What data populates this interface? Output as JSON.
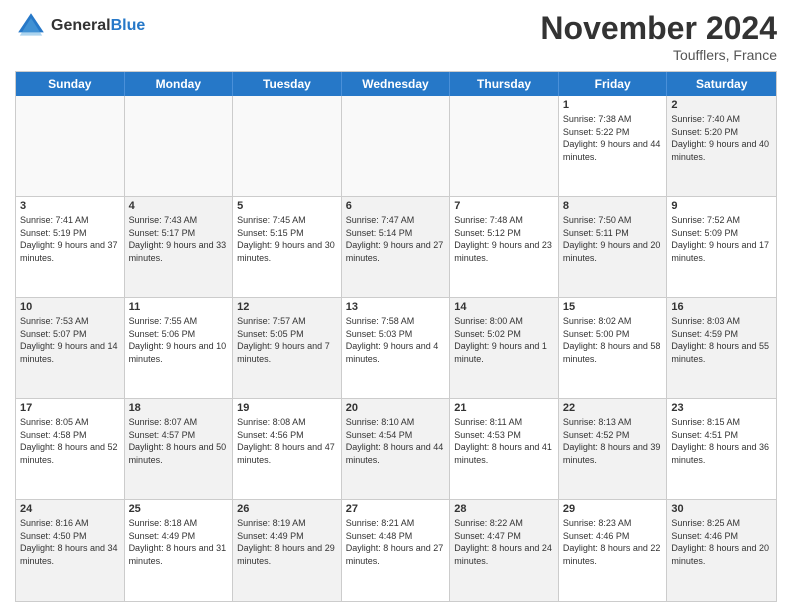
{
  "header": {
    "logo_line1": "General",
    "logo_line2": "Blue",
    "month_title": "November 2024",
    "location": "Toufflers, France"
  },
  "calendar": {
    "days_of_week": [
      "Sunday",
      "Monday",
      "Tuesday",
      "Wednesday",
      "Thursday",
      "Friday",
      "Saturday"
    ],
    "rows": [
      [
        {
          "num": "",
          "info": "",
          "empty": true
        },
        {
          "num": "",
          "info": "",
          "empty": true
        },
        {
          "num": "",
          "info": "",
          "empty": true
        },
        {
          "num": "",
          "info": "",
          "empty": true
        },
        {
          "num": "",
          "info": "",
          "empty": true
        },
        {
          "num": "1",
          "info": "Sunrise: 7:38 AM\nSunset: 5:22 PM\nDaylight: 9 hours\nand 44 minutes.",
          "shaded": false
        },
        {
          "num": "2",
          "info": "Sunrise: 7:40 AM\nSunset: 5:20 PM\nDaylight: 9 hours\nand 40 minutes.",
          "shaded": true
        }
      ],
      [
        {
          "num": "3",
          "info": "Sunrise: 7:41 AM\nSunset: 5:19 PM\nDaylight: 9 hours\nand 37 minutes.",
          "shaded": false
        },
        {
          "num": "4",
          "info": "Sunrise: 7:43 AM\nSunset: 5:17 PM\nDaylight: 9 hours\nand 33 minutes.",
          "shaded": true
        },
        {
          "num": "5",
          "info": "Sunrise: 7:45 AM\nSunset: 5:15 PM\nDaylight: 9 hours\nand 30 minutes.",
          "shaded": false
        },
        {
          "num": "6",
          "info": "Sunrise: 7:47 AM\nSunset: 5:14 PM\nDaylight: 9 hours\nand 27 minutes.",
          "shaded": true
        },
        {
          "num": "7",
          "info": "Sunrise: 7:48 AM\nSunset: 5:12 PM\nDaylight: 9 hours\nand 23 minutes.",
          "shaded": false
        },
        {
          "num": "8",
          "info": "Sunrise: 7:50 AM\nSunset: 5:11 PM\nDaylight: 9 hours\nand 20 minutes.",
          "shaded": true
        },
        {
          "num": "9",
          "info": "Sunrise: 7:52 AM\nSunset: 5:09 PM\nDaylight: 9 hours\nand 17 minutes.",
          "shaded": false
        }
      ],
      [
        {
          "num": "10",
          "info": "Sunrise: 7:53 AM\nSunset: 5:07 PM\nDaylight: 9 hours\nand 14 minutes.",
          "shaded": true
        },
        {
          "num": "11",
          "info": "Sunrise: 7:55 AM\nSunset: 5:06 PM\nDaylight: 9 hours\nand 10 minutes.",
          "shaded": false
        },
        {
          "num": "12",
          "info": "Sunrise: 7:57 AM\nSunset: 5:05 PM\nDaylight: 9 hours\nand 7 minutes.",
          "shaded": true
        },
        {
          "num": "13",
          "info": "Sunrise: 7:58 AM\nSunset: 5:03 PM\nDaylight: 9 hours\nand 4 minutes.",
          "shaded": false
        },
        {
          "num": "14",
          "info": "Sunrise: 8:00 AM\nSunset: 5:02 PM\nDaylight: 9 hours\nand 1 minute.",
          "shaded": true
        },
        {
          "num": "15",
          "info": "Sunrise: 8:02 AM\nSunset: 5:00 PM\nDaylight: 8 hours\nand 58 minutes.",
          "shaded": false
        },
        {
          "num": "16",
          "info": "Sunrise: 8:03 AM\nSunset: 4:59 PM\nDaylight: 8 hours\nand 55 minutes.",
          "shaded": true
        }
      ],
      [
        {
          "num": "17",
          "info": "Sunrise: 8:05 AM\nSunset: 4:58 PM\nDaylight: 8 hours\nand 52 minutes.",
          "shaded": false
        },
        {
          "num": "18",
          "info": "Sunrise: 8:07 AM\nSunset: 4:57 PM\nDaylight: 8 hours\nand 50 minutes.",
          "shaded": true
        },
        {
          "num": "19",
          "info": "Sunrise: 8:08 AM\nSunset: 4:56 PM\nDaylight: 8 hours\nand 47 minutes.",
          "shaded": false
        },
        {
          "num": "20",
          "info": "Sunrise: 8:10 AM\nSunset: 4:54 PM\nDaylight: 8 hours\nand 44 minutes.",
          "shaded": true
        },
        {
          "num": "21",
          "info": "Sunrise: 8:11 AM\nSunset: 4:53 PM\nDaylight: 8 hours\nand 41 minutes.",
          "shaded": false
        },
        {
          "num": "22",
          "info": "Sunrise: 8:13 AM\nSunset: 4:52 PM\nDaylight: 8 hours\nand 39 minutes.",
          "shaded": true
        },
        {
          "num": "23",
          "info": "Sunrise: 8:15 AM\nSunset: 4:51 PM\nDaylight: 8 hours\nand 36 minutes.",
          "shaded": false
        }
      ],
      [
        {
          "num": "24",
          "info": "Sunrise: 8:16 AM\nSunset: 4:50 PM\nDaylight: 8 hours\nand 34 minutes.",
          "shaded": true
        },
        {
          "num": "25",
          "info": "Sunrise: 8:18 AM\nSunset: 4:49 PM\nDaylight: 8 hours\nand 31 minutes.",
          "shaded": false
        },
        {
          "num": "26",
          "info": "Sunrise: 8:19 AM\nSunset: 4:49 PM\nDaylight: 8 hours\nand 29 minutes.",
          "shaded": true
        },
        {
          "num": "27",
          "info": "Sunrise: 8:21 AM\nSunset: 4:48 PM\nDaylight: 8 hours\nand 27 minutes.",
          "shaded": false
        },
        {
          "num": "28",
          "info": "Sunrise: 8:22 AM\nSunset: 4:47 PM\nDaylight: 8 hours\nand 24 minutes.",
          "shaded": true
        },
        {
          "num": "29",
          "info": "Sunrise: 8:23 AM\nSunset: 4:46 PM\nDaylight: 8 hours\nand 22 minutes.",
          "shaded": false
        },
        {
          "num": "30",
          "info": "Sunrise: 8:25 AM\nSunset: 4:46 PM\nDaylight: 8 hours\nand 20 minutes.",
          "shaded": true
        }
      ]
    ]
  }
}
